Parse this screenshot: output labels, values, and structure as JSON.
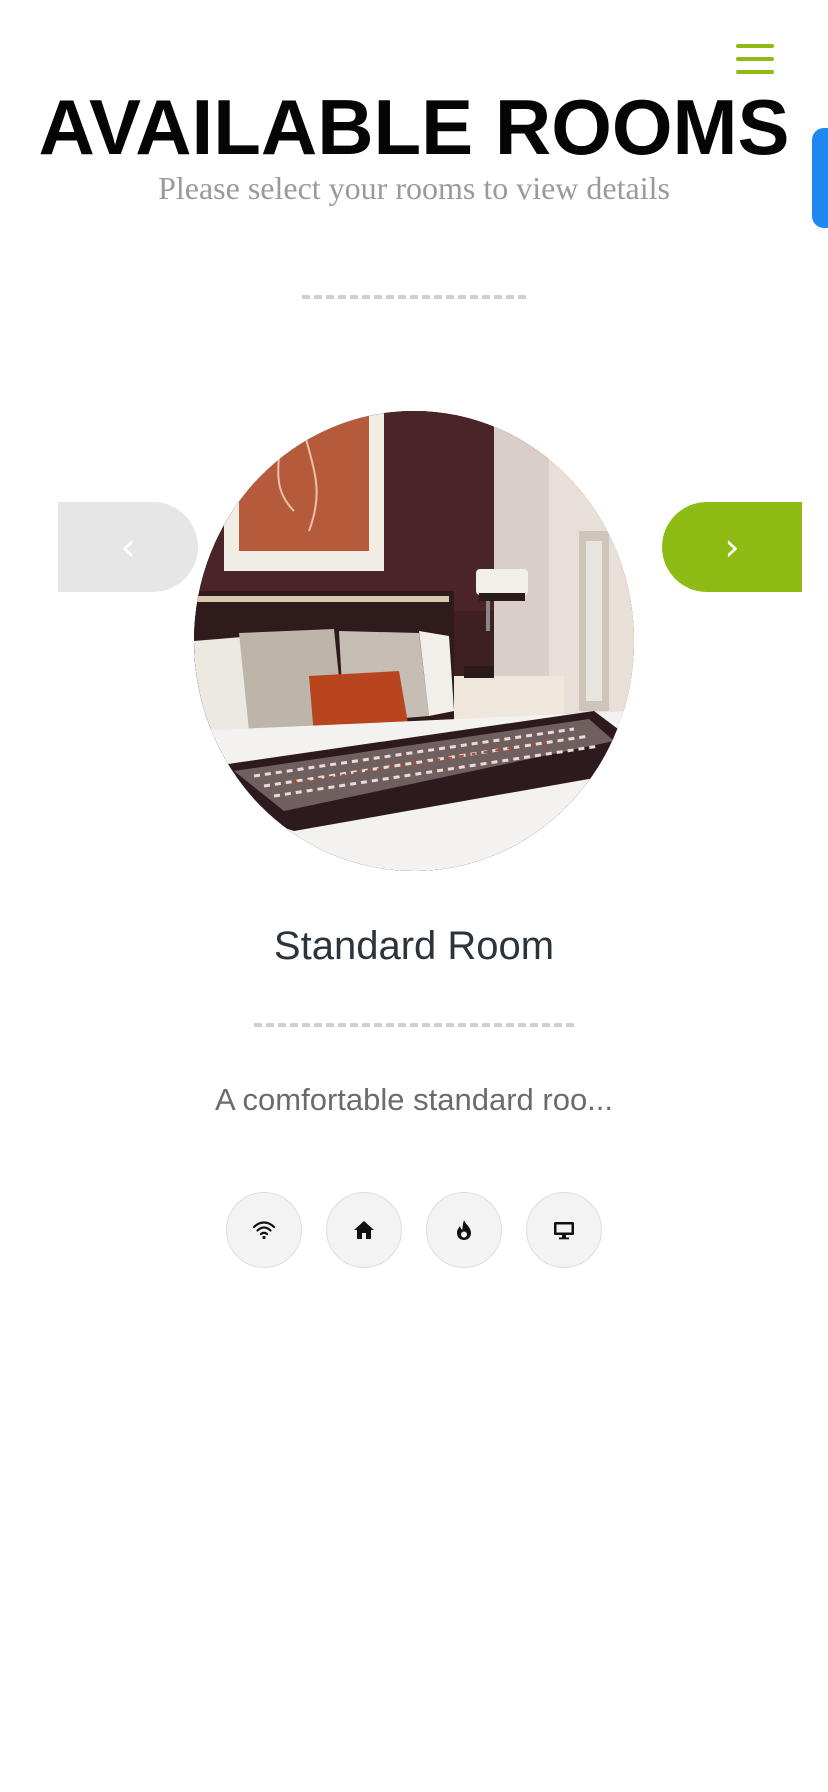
{
  "header": {
    "title": "AVAILABLE ROOMS",
    "subtitle": "Please select your rooms to view details",
    "menu_icon": "hamburger-menu-icon"
  },
  "carousel": {
    "prev_label": "‹",
    "next_label": "›",
    "current_room": {
      "name": "Standard Room",
      "description": "A comfortable standard roo...",
      "amenities": [
        {
          "icon": "wifi-icon"
        },
        {
          "icon": "home-icon"
        },
        {
          "icon": "fire-icon"
        },
        {
          "icon": "tv-icon"
        }
      ]
    }
  },
  "colors": {
    "accent": "#8fbb15",
    "side_tab": "#1e88f0",
    "prev_button": "#e6e6e6",
    "title": "#050505",
    "subtitle": "#9a9a9a",
    "room_name": "#2b333b",
    "description": "#6b6b6b"
  }
}
